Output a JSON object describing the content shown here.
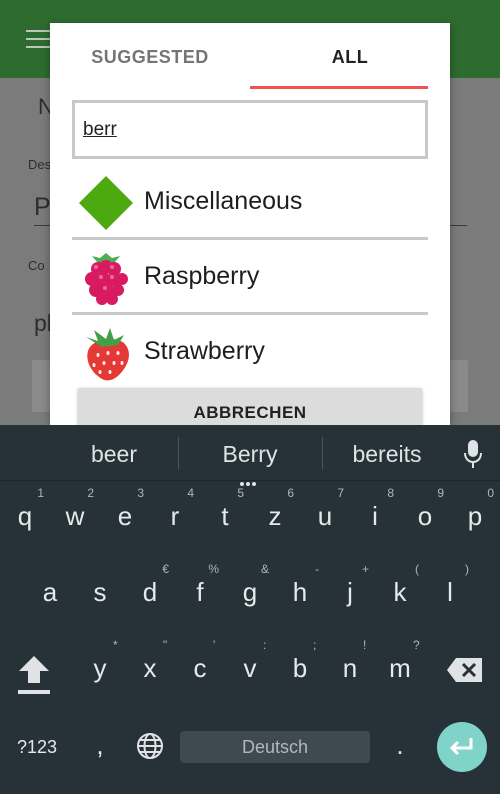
{
  "background": {
    "field_letter_1": "N",
    "field_label_1": "Des",
    "field_value_1": "P",
    "field_label_2": "Co",
    "field_value_2": "pl",
    "toolbar_color": "#2e6b2f"
  },
  "dialog": {
    "tabs": [
      {
        "label": "SUGGESTED",
        "selected": false
      },
      {
        "label": "ALL",
        "selected": true
      }
    ],
    "accent_color": "#ef5350",
    "search": {
      "value": "berr",
      "placeholder": ""
    },
    "results": [
      {
        "label": "Miscellaneous",
        "icon": "green-diamond-icon"
      },
      {
        "label": "Raspberry",
        "icon": "raspberry-icon"
      },
      {
        "label": "Strawberry",
        "icon": "strawberry-icon"
      }
    ],
    "cancel_label": "ABBRECHEN"
  },
  "keyboard": {
    "suggestions": [
      "beer",
      "Berry",
      "bereits"
    ],
    "row1": [
      {
        "key": "q",
        "hint": "1"
      },
      {
        "key": "w",
        "hint": "2"
      },
      {
        "key": "e",
        "hint": "3"
      },
      {
        "key": "r",
        "hint": "4"
      },
      {
        "key": "t",
        "hint": "5"
      },
      {
        "key": "z",
        "hint": "6"
      },
      {
        "key": "u",
        "hint": "7"
      },
      {
        "key": "i",
        "hint": "8"
      },
      {
        "key": "o",
        "hint": "9"
      },
      {
        "key": "p",
        "hint": "0"
      }
    ],
    "row2": [
      {
        "key": "a",
        "hint": ""
      },
      {
        "key": "s",
        "hint": ""
      },
      {
        "key": "d",
        "hint": "€"
      },
      {
        "key": "f",
        "hint": "%"
      },
      {
        "key": "g",
        "hint": "&"
      },
      {
        "key": "h",
        "hint": "-"
      },
      {
        "key": "j",
        "hint": "+"
      },
      {
        "key": "k",
        "hint": "("
      },
      {
        "key": "l",
        "hint": ")"
      }
    ],
    "row3": [
      {
        "key": "y",
        "hint": "*"
      },
      {
        "key": "x",
        "hint": "\""
      },
      {
        "key": "c",
        "hint": "'"
      },
      {
        "key": "v",
        "hint": ":"
      },
      {
        "key": "b",
        "hint": ";"
      },
      {
        "key": "n",
        "hint": "!"
      },
      {
        "key": "m",
        "hint": "?"
      }
    ],
    "symbols_label": "?123",
    "comma_label": ",",
    "period_label": ".",
    "space_label": "Deutsch",
    "enter_color": "#7fd3c9"
  }
}
